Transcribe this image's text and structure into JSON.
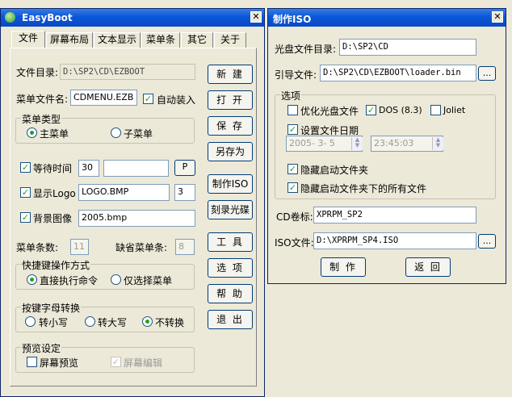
{
  "easyboot": {
    "title": "EasyBoot",
    "close": "✕",
    "tabs": [
      {
        "label": "文件"
      },
      {
        "label": "屏幕布局"
      },
      {
        "label": "文本显示"
      },
      {
        "label": "菜单条"
      },
      {
        "label": "其它"
      },
      {
        "label": "关于"
      }
    ],
    "file_dir_label": "文件目录:",
    "file_dir_value": "D:\\SP2\\CD\\EZBOOT",
    "menu_file_label": "菜单文件名:",
    "menu_file_value": "CDMENU.EZB",
    "auto_load_label": "自动装入",
    "menu_type": {
      "title": "菜单类型",
      "main_label": "主菜单",
      "sub_label": "子菜单"
    },
    "wait_time_label": "等待时间",
    "wait_time_value": "30",
    "wait_extra_value": "",
    "p_button": "P",
    "show_logo_label": "显示Logo",
    "logo_value": "LOGO.BMP",
    "logo_num_value": "3",
    "bg_image_label": "背景图像",
    "bg_value": "2005.bmp",
    "menu_count_label": "菜单条数:",
    "menu_count_value": "11",
    "default_menu_label": "缺省菜单条:",
    "default_menu_value": "8",
    "shortcut": {
      "title": "快捷键操作方式",
      "exec_label": "直接执行命令",
      "select_label": "仅选择菜单"
    },
    "case_convert": {
      "title": "按键字母转换",
      "lower_label": "转小写",
      "upper_label": "转大写",
      "none_label": "不转换"
    },
    "preview": {
      "title": "预览设定",
      "screen_label": "屏幕预览",
      "edit_label": "屏幕编辑"
    },
    "buttons": {
      "new": "新 建",
      "open": "打 开",
      "save": "保 存",
      "save_as": "另存为",
      "make_iso": "制作ISO",
      "burn": "刻录光碟",
      "tools": "工 具",
      "options": "选 项",
      "help": "帮 助",
      "exit": "退 出"
    }
  },
  "make_iso": {
    "title": "制作ISO",
    "close": "✕",
    "cd_dir_label": "光盘文件目录:",
    "cd_dir_value": "D:\\SP2\\CD",
    "boot_file_label": "引导文件:",
    "boot_file_value": "D:\\SP2\\CD\\EZBOOT\\loader.bin",
    "browse": "...",
    "options": {
      "title": "选项",
      "optimize_label": "优化光盘文件",
      "dos_label": "DOS (8.3)",
      "joliet_label": "Joliet",
      "set_date_label": "设置文件日期",
      "date_value": "2005- 3- 5",
      "time_value": "23:45:03",
      "hide_folder_label": "隐藏启动文件夹",
      "hide_all_label": "隐藏启动文件夹下的所有文件"
    },
    "volume_label": "CD卷标:",
    "volume_value": "XPRPM_SP2",
    "iso_file_label": "ISO文件:",
    "iso_file_value": "D:\\XPRPM_SP4.ISO",
    "make_button": "制 作",
    "back_button": "返 回"
  },
  "colors": {
    "titlebar": "#0b56d9",
    "check": "#21a121",
    "face": "#ece9d8"
  }
}
